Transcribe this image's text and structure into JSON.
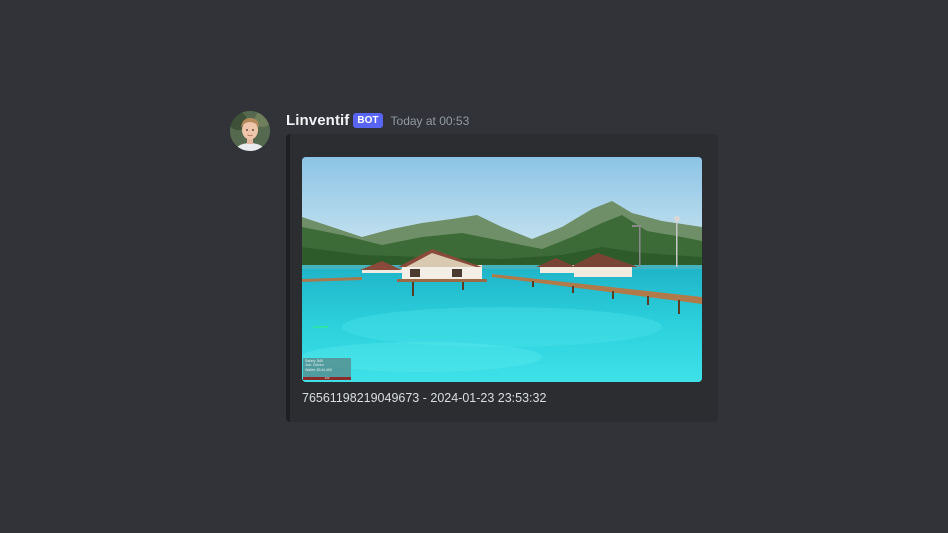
{
  "message": {
    "author": "Linventif",
    "bot_tag": "BOT",
    "timestamp": "Today at 00:53"
  },
  "embed": {
    "footer_text": "76561198219049673 - 2024-01-23 23:53:32",
    "screenshot": {
      "player_tag": "Linventif",
      "hud_lines": [
        "Salary: $40",
        "Job: Citizen",
        "Wallet: $144,400"
      ],
      "hud_health": "100",
      "center_lines": [
        "",
        ""
      ]
    }
  },
  "colors": {
    "background": "#313338",
    "embed_bg": "#2b2d31",
    "embed_border": "#1e1f22",
    "bot_tag": "#5865f2",
    "username": "#f2f3f5",
    "timestamp": "#949ba4",
    "footer_text": "#dbdee1"
  }
}
